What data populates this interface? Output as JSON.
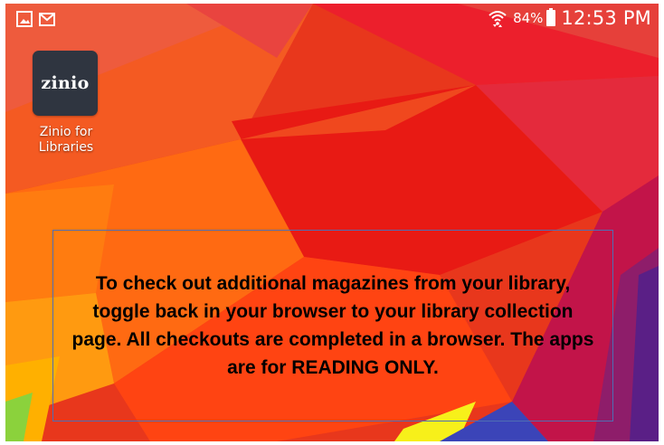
{
  "status_bar": {
    "left_icons": [
      "gallery-notification-icon",
      "gmail-notification-icon"
    ],
    "wifi_icon": "wifi-icon",
    "battery_percent": "84%",
    "battery_level": 0.84,
    "time": "12:53 PM"
  },
  "home_screen": {
    "app": {
      "icon_text": "zinio",
      "label": "Zinio for Libraries",
      "icon_color": "#2f3540"
    }
  },
  "notice": {
    "text": "To check out additional magazines from your library, toggle back in your browser to your library collection page. All checkouts are completed in a browser. The apps are for READING ONLY.",
    "border_color": "#4f6eb3"
  },
  "colors": {
    "wallpaper_primary": "#e0321e",
    "wallpaper_accent_orange": "#ff8a00",
    "wallpaper_accent_magenta": "#c0184a"
  }
}
